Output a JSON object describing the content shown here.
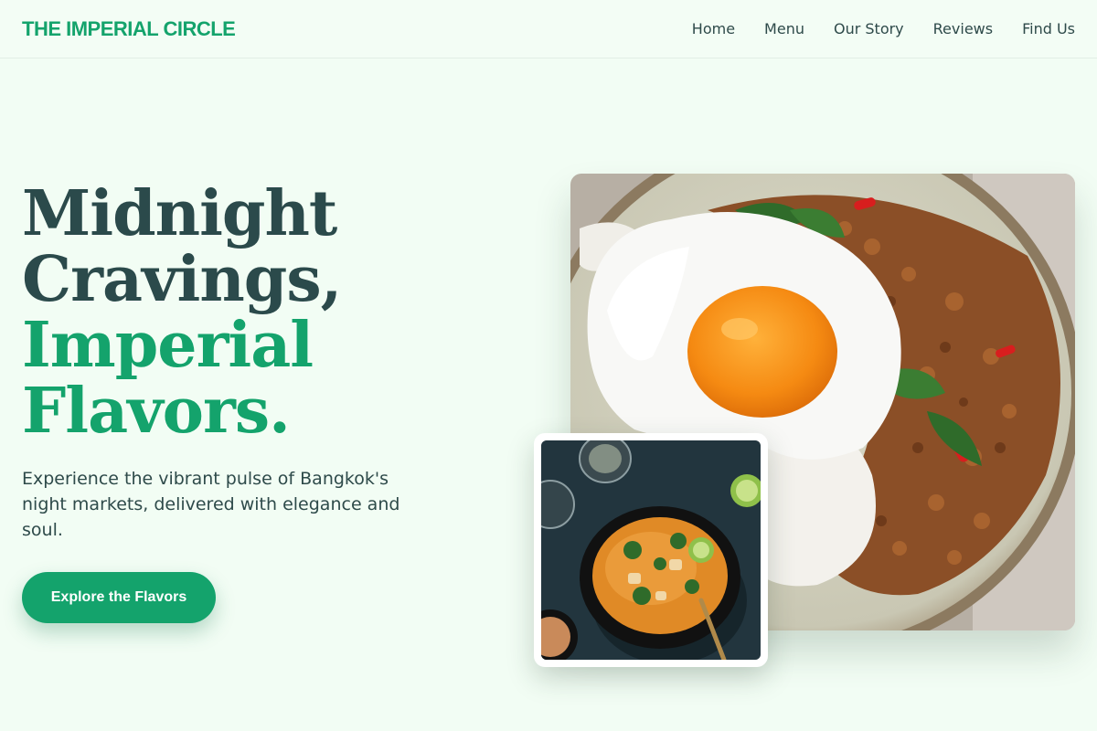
{
  "brand": {
    "name": "THE IMPERIAL CIRCLE"
  },
  "nav": {
    "items": [
      "Home",
      "Menu",
      "Our Story",
      "Reviews",
      "Find Us"
    ]
  },
  "hero": {
    "headline_lines": [
      "Midnight",
      "Cravings,",
      "Imperial",
      "Flavors."
    ],
    "subtitle": "Experience the vibrant pulse of Bangkok's night markets, delivered with elegance and soul.",
    "cta_label": "Explore the Flavors"
  },
  "colors": {
    "accent": "#14a36c",
    "heading_dark": "#2b4a4b",
    "background": "#f2fdf4"
  },
  "images": {
    "main": "basil-pork-rice-with-fried-egg",
    "inset": "thai-curry-bowl"
  }
}
